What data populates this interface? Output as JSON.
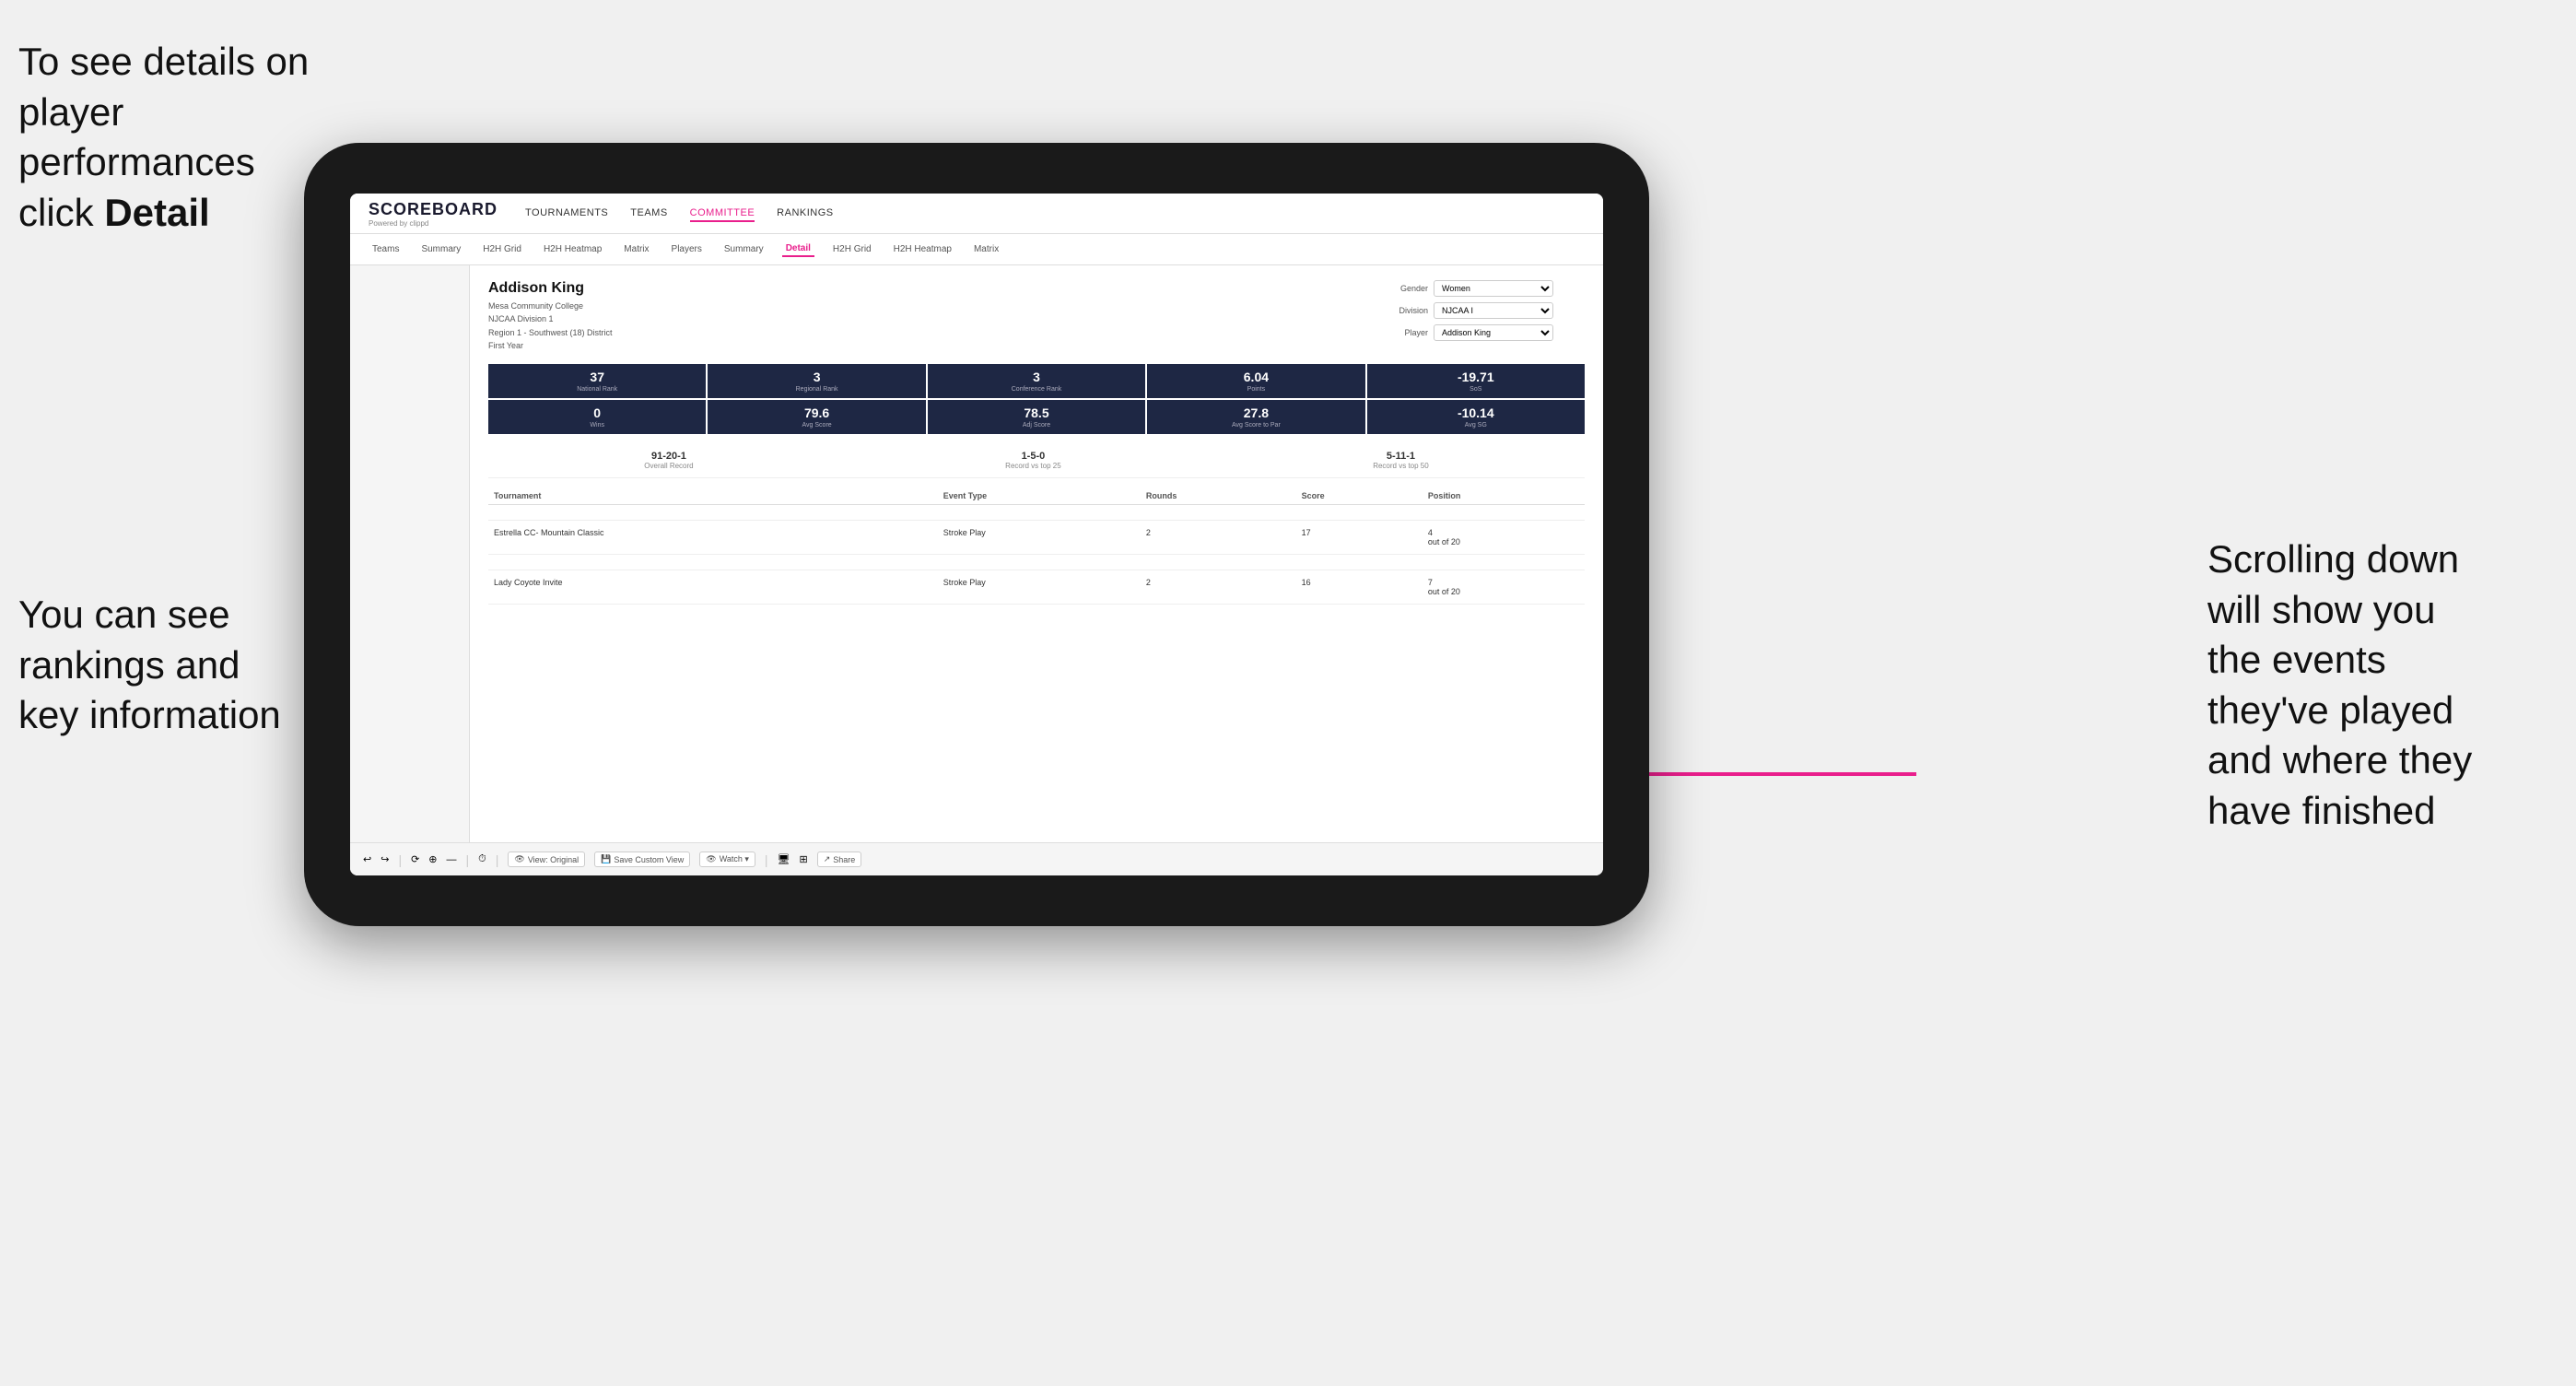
{
  "annotations": {
    "top_left": "To see details on player performances click ",
    "top_left_bold": "Detail",
    "bottom_left_line1": "You can see",
    "bottom_left_line2": "rankings and",
    "bottom_left_line3": "key information",
    "bottom_right_line1": "Scrolling down",
    "bottom_right_line2": "will show you",
    "bottom_right_line3": "the events",
    "bottom_right_line4": "they've played",
    "bottom_right_line5": "and where they",
    "bottom_right_line6": "have finished"
  },
  "nav": {
    "logo": "SCOREBOARD",
    "logo_sub": "Powered by clippd",
    "items": [
      "TOURNAMENTS",
      "TEAMS",
      "COMMITTEE",
      "RANKINGS"
    ],
    "active_item": "COMMITTEE"
  },
  "sub_nav": {
    "items": [
      "Teams",
      "Summary",
      "H2H Grid",
      "H2H Heatmap",
      "Matrix",
      "Players",
      "Summary",
      "Detail",
      "H2H Grid",
      "H2H Heatmap",
      "Matrix"
    ],
    "active_item": "Detail"
  },
  "player": {
    "name": "Addison King",
    "school": "Mesa Community College",
    "division": "NJCAA Division 1",
    "region": "Region 1 - Southwest (18) District",
    "year": "First Year",
    "gender_label": "Gender",
    "gender_value": "Women",
    "division_label": "Division",
    "division_value": "NJCAA I",
    "player_label": "Player",
    "player_value": "Addison King"
  },
  "stats_row1": [
    {
      "value": "37",
      "label": "National Rank"
    },
    {
      "value": "3",
      "label": "Regional Rank"
    },
    {
      "value": "3",
      "label": "Conference Rank"
    },
    {
      "value": "6.04",
      "label": "Points"
    },
    {
      "value": "-19.71",
      "label": "SoS"
    }
  ],
  "stats_row2": [
    {
      "value": "0",
      "label": "Wins"
    },
    {
      "value": "79.6",
      "label": "Avg Score"
    },
    {
      "value": "78.5",
      "label": "Adj Score"
    },
    {
      "value": "27.8",
      "label": "Avg Score to Par"
    },
    {
      "value": "-10.14",
      "label": "Avg SG"
    }
  ],
  "records": [
    {
      "value": "91-20-1",
      "label": "Overall Record"
    },
    {
      "value": "1-5-0",
      "label": "Record vs top 25"
    },
    {
      "value": "5-11-1",
      "label": "Record vs top 50"
    }
  ],
  "table": {
    "headers": [
      "Tournament",
      "Event Type",
      "Rounds",
      "Score",
      "Position"
    ],
    "rows": [
      {
        "tournament": "Estrella CC- Mountain Classic",
        "event_type": "Stroke Play",
        "rounds": "2",
        "score": "17",
        "position": "4 out of 20"
      },
      {
        "tournament": "Lady Coyote Invite",
        "event_type": "Stroke Play",
        "rounds": "2",
        "score": "16",
        "position": "7 out of 20"
      }
    ]
  },
  "toolbar": {
    "buttons": [
      "View: Original",
      "Save Custom View",
      "Watch ▾",
      "Share"
    ]
  }
}
